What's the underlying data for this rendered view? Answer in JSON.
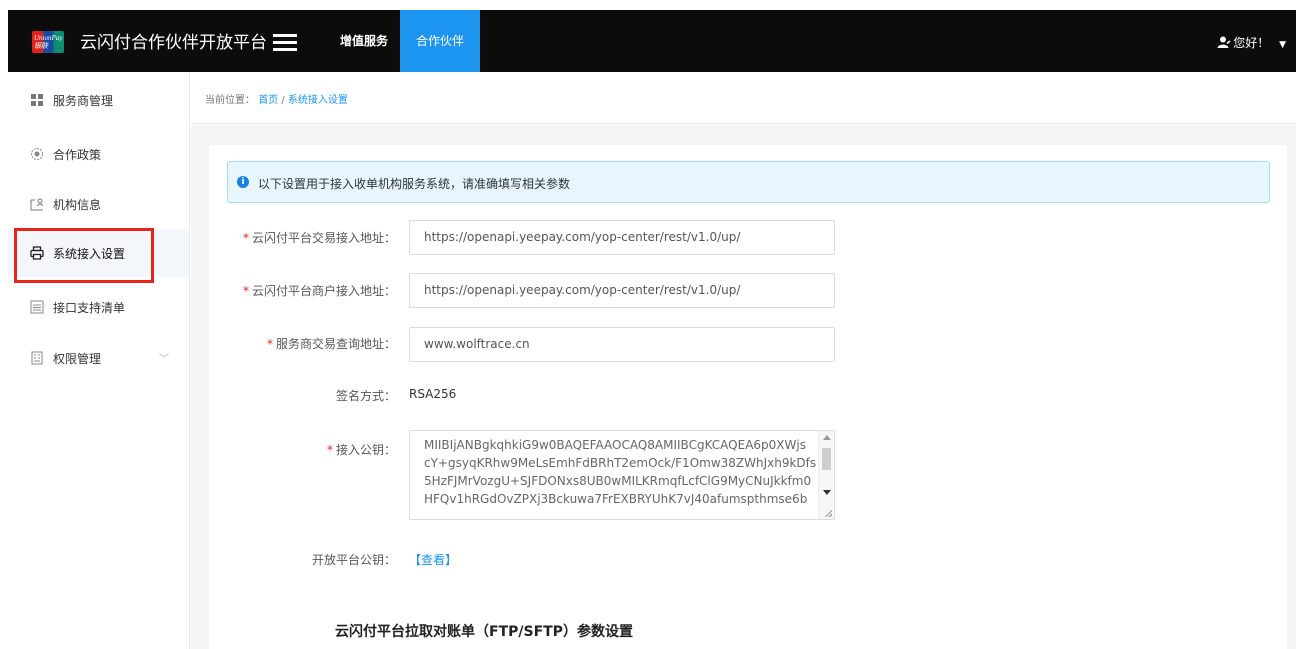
{
  "header": {
    "logo_text": "UnionPay 银联",
    "app_title": "云闪付合作伙伴开放平台",
    "tabs": [
      {
        "label": "增值服务",
        "active": false
      },
      {
        "label": "合作伙伴",
        "active": true
      }
    ],
    "user_greeting": "您好！",
    "user_dropdown_icon": "caret-down-icon"
  },
  "sidebar": {
    "items": [
      {
        "label": "服务商管理",
        "icon": "grid-icon"
      },
      {
        "label": "合作政策",
        "icon": "target-icon"
      },
      {
        "label": "机构信息",
        "icon": "id-card-icon"
      },
      {
        "label": "系统接入设置",
        "icon": "printer-icon",
        "active": true
      },
      {
        "label": "接口支持清单",
        "icon": "list-icon"
      },
      {
        "label": "权限管理",
        "icon": "building-icon",
        "expandable": true
      }
    ]
  },
  "breadcrumb": {
    "prefix": "当前位置：",
    "home": "首页",
    "separator": "/",
    "current": "系统接入设置"
  },
  "notice": {
    "text": "以下设置用于接入收单机构服务系统，请准确填写相关参数"
  },
  "form": {
    "trade_url": {
      "label": "云闪付平台交易接入地址：",
      "required": true,
      "value": "https://openapi.yeepay.com/yop-center/rest/v1.0/up/"
    },
    "merchant_url": {
      "label": "云闪付平台商户接入地址：",
      "required": true,
      "value": "https://openapi.yeepay.com/yop-center/rest/v1.0/up/"
    },
    "query_url": {
      "label": "服务商交易查询地址：",
      "required": true,
      "value": "www.wolftrace.cn"
    },
    "sign_method": {
      "label": "签名方式：",
      "value": "RSA256"
    },
    "public_key": {
      "label": "接入公钥：",
      "required": true,
      "lines": [
        "MIIBIjANBgkqhkiG9w0BAQEFAAOCAQ8AMIIBCgKCAQEA6p0XWjs",
        "cY+gsyqKRhw9MeLsEmhFdBRhT2emOck/F1Omw38ZWhJxh9kDfs",
        "5HzFJMrVozgU+SJFDONxs8UB0wMILKRmqfLcfClG9MyCNuJkkfm0",
        "HFQv1hRGdOvZPXj3Bckuwa7FrEXBRYUhK7vJ40afumspthmse6b"
      ]
    },
    "platform_key": {
      "label": "开放平台公钥：",
      "link": "【查看】"
    }
  },
  "section": {
    "title": "云闪付平台拉取对账单（FTP/SFTP）参数设置"
  }
}
